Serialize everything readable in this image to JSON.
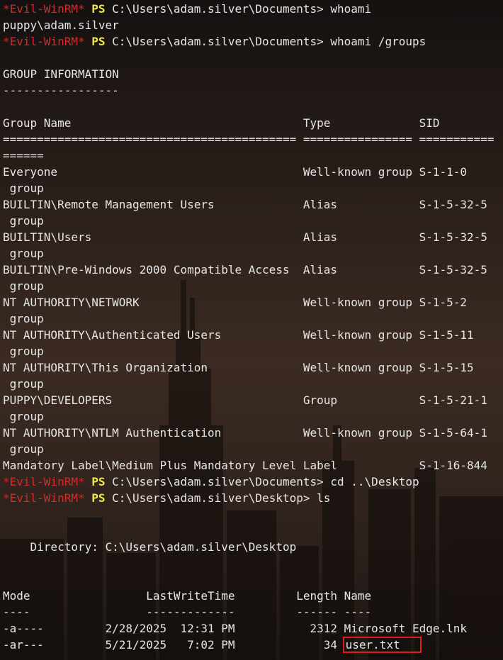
{
  "colors": {
    "prompt_red": "#d42a2a",
    "prompt_yellow": "#f2e94e",
    "output_text": "#e6e6e6",
    "highlight_box": "#e11b1b"
  },
  "terminal": {
    "prompt_tag": "*Evil-WinRM*",
    "prompt_ps": "PS",
    "cmd1_path": " C:\\Users\\adam.silver\\Documents> whoami",
    "out1": "puppy\\adam.silver",
    "cmd2_path": " C:\\Users\\adam.silver\\Documents> whoami /groups",
    "group_info_title": "GROUP INFORMATION",
    "group_info_underline": "-----------------",
    "groups_header": "Group Name                                  Type             SID",
    "groups_rule": "=========================================== ================ ===========",
    "groups_rule_wrap": "======",
    "group_rows": [
      {
        "text": "Everyone                                    Well-known group S-1-1-0",
        "wrap": " group"
      },
      {
        "text": "BUILTIN\\Remote Management Users             Alias            S-1-5-32-5",
        "wrap": " group"
      },
      {
        "text": "BUILTIN\\Users                               Alias            S-1-5-32-5",
        "wrap": " group"
      },
      {
        "text": "BUILTIN\\Pre-Windows 2000 Compatible Access  Alias            S-1-5-32-5",
        "wrap": " group"
      },
      {
        "text": "NT AUTHORITY\\NETWORK                        Well-known group S-1-5-2",
        "wrap": " group"
      },
      {
        "text": "NT AUTHORITY\\Authenticated Users            Well-known group S-1-5-11",
        "wrap": " group"
      },
      {
        "text": "NT AUTHORITY\\This Organization              Well-known group S-1-5-15",
        "wrap": " group"
      },
      {
        "text": "PUPPY\\DEVELOPERS                            Group            S-1-5-21-1",
        "wrap": " group"
      },
      {
        "text": "NT AUTHORITY\\NTLM Authentication            Well-known group S-1-5-64-1",
        "wrap": " group"
      }
    ],
    "mandatory_row": "Mandatory Label\\Medium Plus Mandatory Level Label            S-1-16-844",
    "cmd3_path": " C:\\Users\\adam.silver\\Documents> cd ..\\Desktop",
    "cmd4_path": " C:\\Users\\adam.silver\\Desktop> ls",
    "directory_line": "    Directory: C:\\Users\\adam.silver\\Desktop",
    "listing_header": "Mode                 LastWriteTime         Length Name",
    "listing_rule": "----                 -------------         ------ ----",
    "file1": "-a----         2/28/2025  12:31 PM           2312 Microsoft Edge.lnk",
    "file2_prefix": "-ar---         5/21/2025   7:02 PM             34 ",
    "file2_name": "user.txt"
  }
}
